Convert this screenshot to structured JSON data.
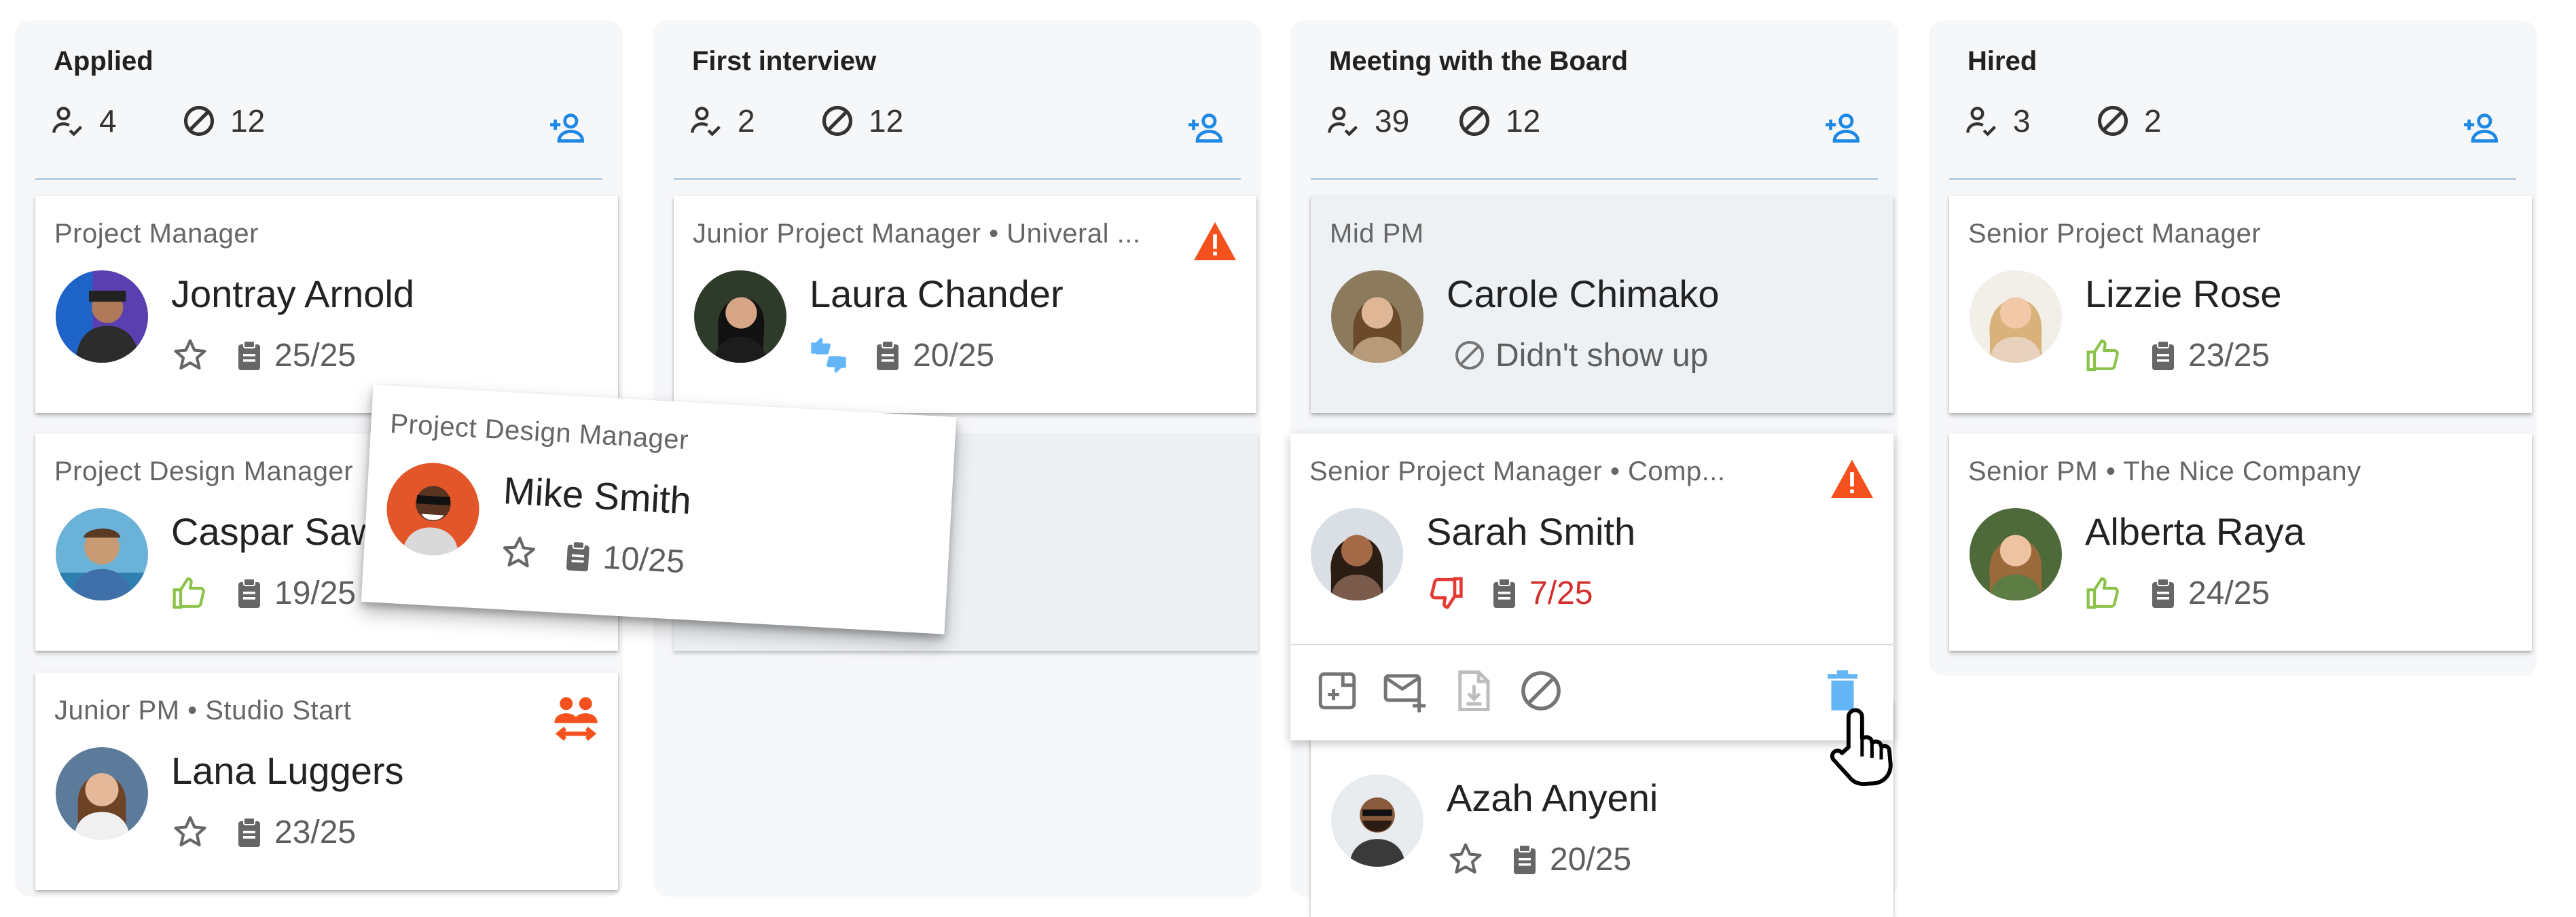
{
  "colors": {
    "accent": "#1e88e5",
    "alert": "#f4511e",
    "thumb_up": "#8bc34a",
    "thumb_down_red": "#e53935",
    "score_red": "#d32f2f",
    "divider": "#b9cee3"
  },
  "columns": [
    {
      "title": "Applied",
      "applied_count": "4",
      "blocked_count": "12",
      "cards": [
        {
          "role": "Project Manager",
          "name": "Jontray Arnold",
          "rating": "star",
          "score": "25/25"
        },
        {
          "role": "Project Design Manager",
          "name": "Caspar Saw",
          "rating": "thumb-up",
          "score": "19/25"
        },
        {
          "role": "Junior PM • Studio Start",
          "name": "Lana Luggers",
          "rating": "star",
          "score": "23/25",
          "badge": "swap-people-icon"
        }
      ]
    },
    {
      "title": "First interview",
      "applied_count": "2",
      "blocked_count": "12",
      "cards": [
        {
          "role": "Junior Project Manager • Univeral ...",
          "name": "Laura Chander",
          "rating": "thumbs-mixed",
          "score": "20/25",
          "badge": "warning-icon"
        }
      ]
    },
    {
      "title": "Meeting with the Board",
      "applied_count": "39",
      "blocked_count": "12",
      "cards": [
        {
          "role": "Mid PM",
          "name": "Carole Chimako",
          "status": "Didn't show up"
        },
        {
          "role": "Senior Project Manager • Comp...",
          "name": "Sarah Smith",
          "rating": "thumb-down",
          "score": "7/25",
          "badge": "warning-icon"
        },
        {
          "name": "Azah Anyeni",
          "rating": "star",
          "score": "20/25"
        }
      ],
      "actions": [
        "add-file-icon",
        "send-email-icon",
        "download-doc-icon",
        "block-icon",
        "delete-icon"
      ]
    },
    {
      "title": "Hired",
      "applied_count": "3",
      "blocked_count": "2",
      "cards": [
        {
          "role": "Senior Project Manager",
          "name": "Lizzie Rose",
          "rating": "thumb-up",
          "score": "23/25"
        },
        {
          "role": "Senior PM • The Nice Company",
          "name": "Alberta Raya",
          "rating": "thumb-up",
          "score": "24/25"
        }
      ]
    }
  ],
  "dragging_card": {
    "role": "Project Design Manager",
    "name": "Mike Smith",
    "rating": "star",
    "score": "10/25"
  }
}
